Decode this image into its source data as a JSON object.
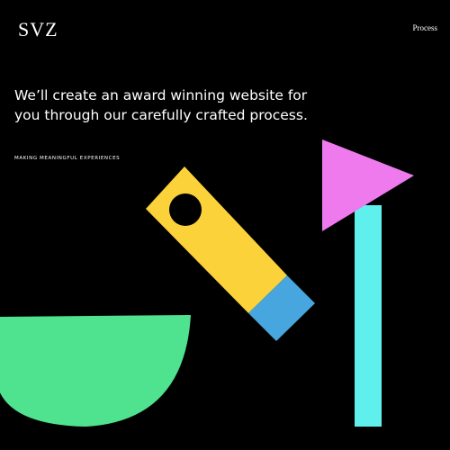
{
  "header": {
    "logo": "SVZ",
    "nav_link": "Process"
  },
  "hero": {
    "headline": "We’ll create an award winning website for you through our carefully crafted process.",
    "tagline": "MAKING MEANINGFUL EXPERIENCES"
  },
  "illustration": {
    "shapes": [
      "green-bowl-shape",
      "yellow-tag-shape",
      "blue-tag-tip-shape",
      "pink-triangle-shape",
      "cyan-pole-shape"
    ],
    "colors": {
      "background": "#000000",
      "green": "#4fe38f",
      "yellow": "#fcd23a",
      "blue": "#47a6de",
      "pink": "#ee7aee",
      "cyan": "#5ff0ee"
    }
  }
}
